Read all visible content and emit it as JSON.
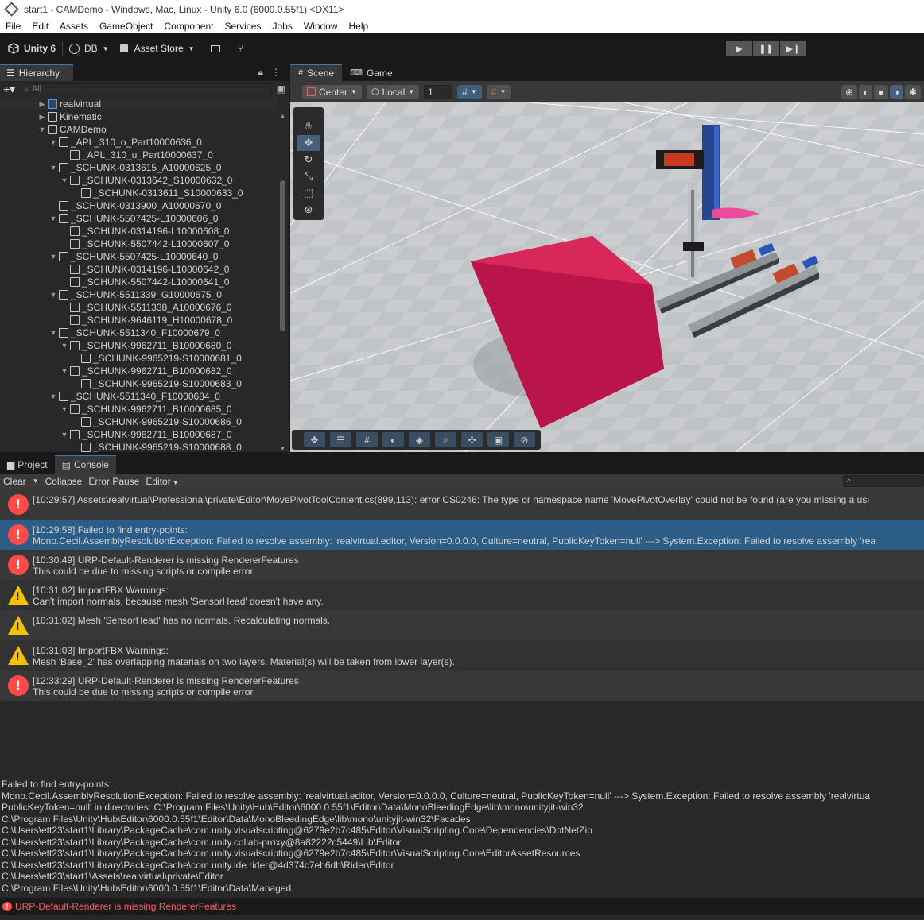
{
  "window": {
    "title": "start1 - CAMDemo - Windows, Mac, Linux - Unity 6.0 (6000.0.55f1) <DX11>"
  },
  "menu": [
    "File",
    "Edit",
    "Assets",
    "GameObject",
    "Component",
    "Services",
    "Jobs",
    "Window",
    "Help"
  ],
  "toolbar": {
    "unity_label": "Unity 6",
    "account_label": "DB",
    "asset_store_label": "Asset Store"
  },
  "hierarchy": {
    "tab_label": "Hierarchy",
    "search_placeholder": "All",
    "items": [
      {
        "label": "realvirtual",
        "depth": 0,
        "expand": "collapsed"
      },
      {
        "label": "Kinematic",
        "depth": 0,
        "expand": "collapsed"
      },
      {
        "label": "CAMDemo",
        "depth": 0,
        "expand": "expanded"
      },
      {
        "label": "_APL_310_o_Part10000636_0",
        "depth": 1,
        "expand": "expanded"
      },
      {
        "label": "_APL_310_u_Part10000637_0",
        "depth": 2,
        "expand": "none"
      },
      {
        "label": "_SCHUNK-0313615_A10000625_0",
        "depth": 1,
        "expand": "expanded"
      },
      {
        "label": "_SCHUNK-0313642_S10000632_0",
        "depth": 2,
        "expand": "expanded"
      },
      {
        "label": "_SCHUNK-0313611_S10000633_0",
        "depth": 3,
        "expand": "none"
      },
      {
        "label": "_SCHUNK-0313900_A10000670_0",
        "depth": 1,
        "expand": "none"
      },
      {
        "label": "_SCHUNK-5507425-L10000606_0",
        "depth": 1,
        "expand": "expanded"
      },
      {
        "label": "_SCHUNK-0314196-L10000608_0",
        "depth": 2,
        "expand": "none"
      },
      {
        "label": "_SCHUNK-5507442-L10000607_0",
        "depth": 2,
        "expand": "none"
      },
      {
        "label": "_SCHUNK-5507425-L10000640_0",
        "depth": 1,
        "expand": "expanded"
      },
      {
        "label": "_SCHUNK-0314196-L10000642_0",
        "depth": 2,
        "expand": "none"
      },
      {
        "label": "_SCHUNK-5507442-L10000641_0",
        "depth": 2,
        "expand": "none"
      },
      {
        "label": "_SCHUNK-5511339_G10000675_0",
        "depth": 1,
        "expand": "expanded"
      },
      {
        "label": "_SCHUNK-5511338_A10000676_0",
        "depth": 2,
        "expand": "none"
      },
      {
        "label": "_SCHUNK-9646119_H10000678_0",
        "depth": 2,
        "expand": "none"
      },
      {
        "label": "_SCHUNK-5511340_F10000679_0",
        "depth": 1,
        "expand": "expanded"
      },
      {
        "label": "_SCHUNK-9962711_B10000680_0",
        "depth": 2,
        "expand": "expanded"
      },
      {
        "label": "_SCHUNK-9965219-S10000681_0",
        "depth": 3,
        "expand": "none"
      },
      {
        "label": "_SCHUNK-9962711_B10000682_0",
        "depth": 2,
        "expand": "expanded"
      },
      {
        "label": "_SCHUNK-9965219-S10000683_0",
        "depth": 3,
        "expand": "none"
      },
      {
        "label": "_SCHUNK-5511340_F10000684_0",
        "depth": 1,
        "expand": "expanded"
      },
      {
        "label": "_SCHUNK-9962711_B10000685_0",
        "depth": 2,
        "expand": "expanded"
      },
      {
        "label": "_SCHUNK-9965219-S10000686_0",
        "depth": 3,
        "expand": "none"
      },
      {
        "label": "_SCHUNK-9962711_B10000687_0",
        "depth": 2,
        "expand": "expanded"
      },
      {
        "label": "_SCHUNK-9965219-S10000688_0",
        "depth": 3,
        "expand": "none"
      }
    ]
  },
  "scene": {
    "tabs": [
      "Scene",
      "Game"
    ],
    "pivot_label": "Center",
    "space_label": "Local",
    "grid_value": "1"
  },
  "console": {
    "tabs": [
      "Project",
      "Console"
    ],
    "toolbar": [
      "Clear",
      "Collapse",
      "Error Pause",
      "Editor"
    ],
    "entries": [
      {
        "type": "error",
        "line1": "[10:29:57] Assets\\realvirtual\\Professional\\private\\Editor\\MovePivotToolContent.cs(899,113): error CS0246: The type or namespace name 'MovePivotOverlay' could not be found (are you missing a usi",
        "line2": ""
      },
      {
        "type": "error",
        "line1": "[10:29:58] Failed to find entry-points:",
        "line2": "Mono.Cecil.AssemblyResolutionException: Failed to resolve assembly: 'realvirtual.editor, Version=0.0.0.0, Culture=neutral, PublicKeyToken=null' ---> System.Exception: Failed to resolve assembly 'rea",
        "selected": true
      },
      {
        "type": "error",
        "line1": "[10:30:49] URP-Default-Renderer is missing RendererFeatures",
        "line2": "This could be due to missing scripts or compile error."
      },
      {
        "type": "warning",
        "line1": "[10:31:02] ImportFBX Warnings:",
        "line2": "Can't import normals, because mesh 'SensorHead' doesn't have any."
      },
      {
        "type": "warning",
        "line1": "[10:31:02] Mesh 'SensorHead' has no normals. Recalculating normals.",
        "line2": ""
      },
      {
        "type": "warning",
        "line1": "[10:31:03] ImportFBX Warnings:",
        "line2": "Mesh 'Base_2' has overlapping materials on two layers. Material(s) will be taken from lower layer(s)."
      },
      {
        "type": "error",
        "line1": "[12:33:29] URP-Default-Renderer is missing RendererFeatures",
        "line2": "This could be due to missing scripts or compile error."
      }
    ],
    "detail": "Failed to find entry-points:\nMono.Cecil.AssemblyResolutionException: Failed to resolve assembly: 'realvirtual.editor, Version=0.0.0.0, Culture=neutral, PublicKeyToken=null' ---> System.Exception: Failed to resolve assembly 'realvirtua\nPublicKeyToken=null' in directories: C:\\Program Files\\Unity\\Hub\\Editor\\6000.0.55f1\\Editor\\Data\\MonoBleedingEdge\\lib\\mono\\unityjit-win32\nC:\\Program Files\\Unity\\Hub\\Editor\\6000.0.55f1\\Editor\\Data\\MonoBleedingEdge\\lib\\mono\\unityjit-win32\\Facades\nC:\\Users\\ett23\\start1\\Library\\PackageCache\\com.unity.visualscripting@6279e2b7c485\\Editor\\VisualScripting.Core\\Dependencies\\DotNetZip\nC:\\Users\\ett23\\start1\\Library\\PackageCache\\com.unity.collab-proxy@8a82222c5449\\Lib\\Editor\nC:\\Users\\ett23\\start1\\Library\\PackageCache\\com.unity.visualscripting@6279e2b7c485\\Editor\\VisualScripting.Core\\EditorAssetResources\nC:\\Users\\ett23\\start1\\Library\\PackageCache\\com.unity.ide.rider@4d374c7eb6db\\Rider\\Editor\nC:\\Users\\ett23\\start1\\Assets\\realvirtual\\private\\Editor\nC:\\Program Files\\Unity\\Hub\\Editor\\6000.0.55f1\\Editor\\Data\\Managed",
    "status_text": "URP-Default-Renderer is missing RendererFeatures"
  }
}
